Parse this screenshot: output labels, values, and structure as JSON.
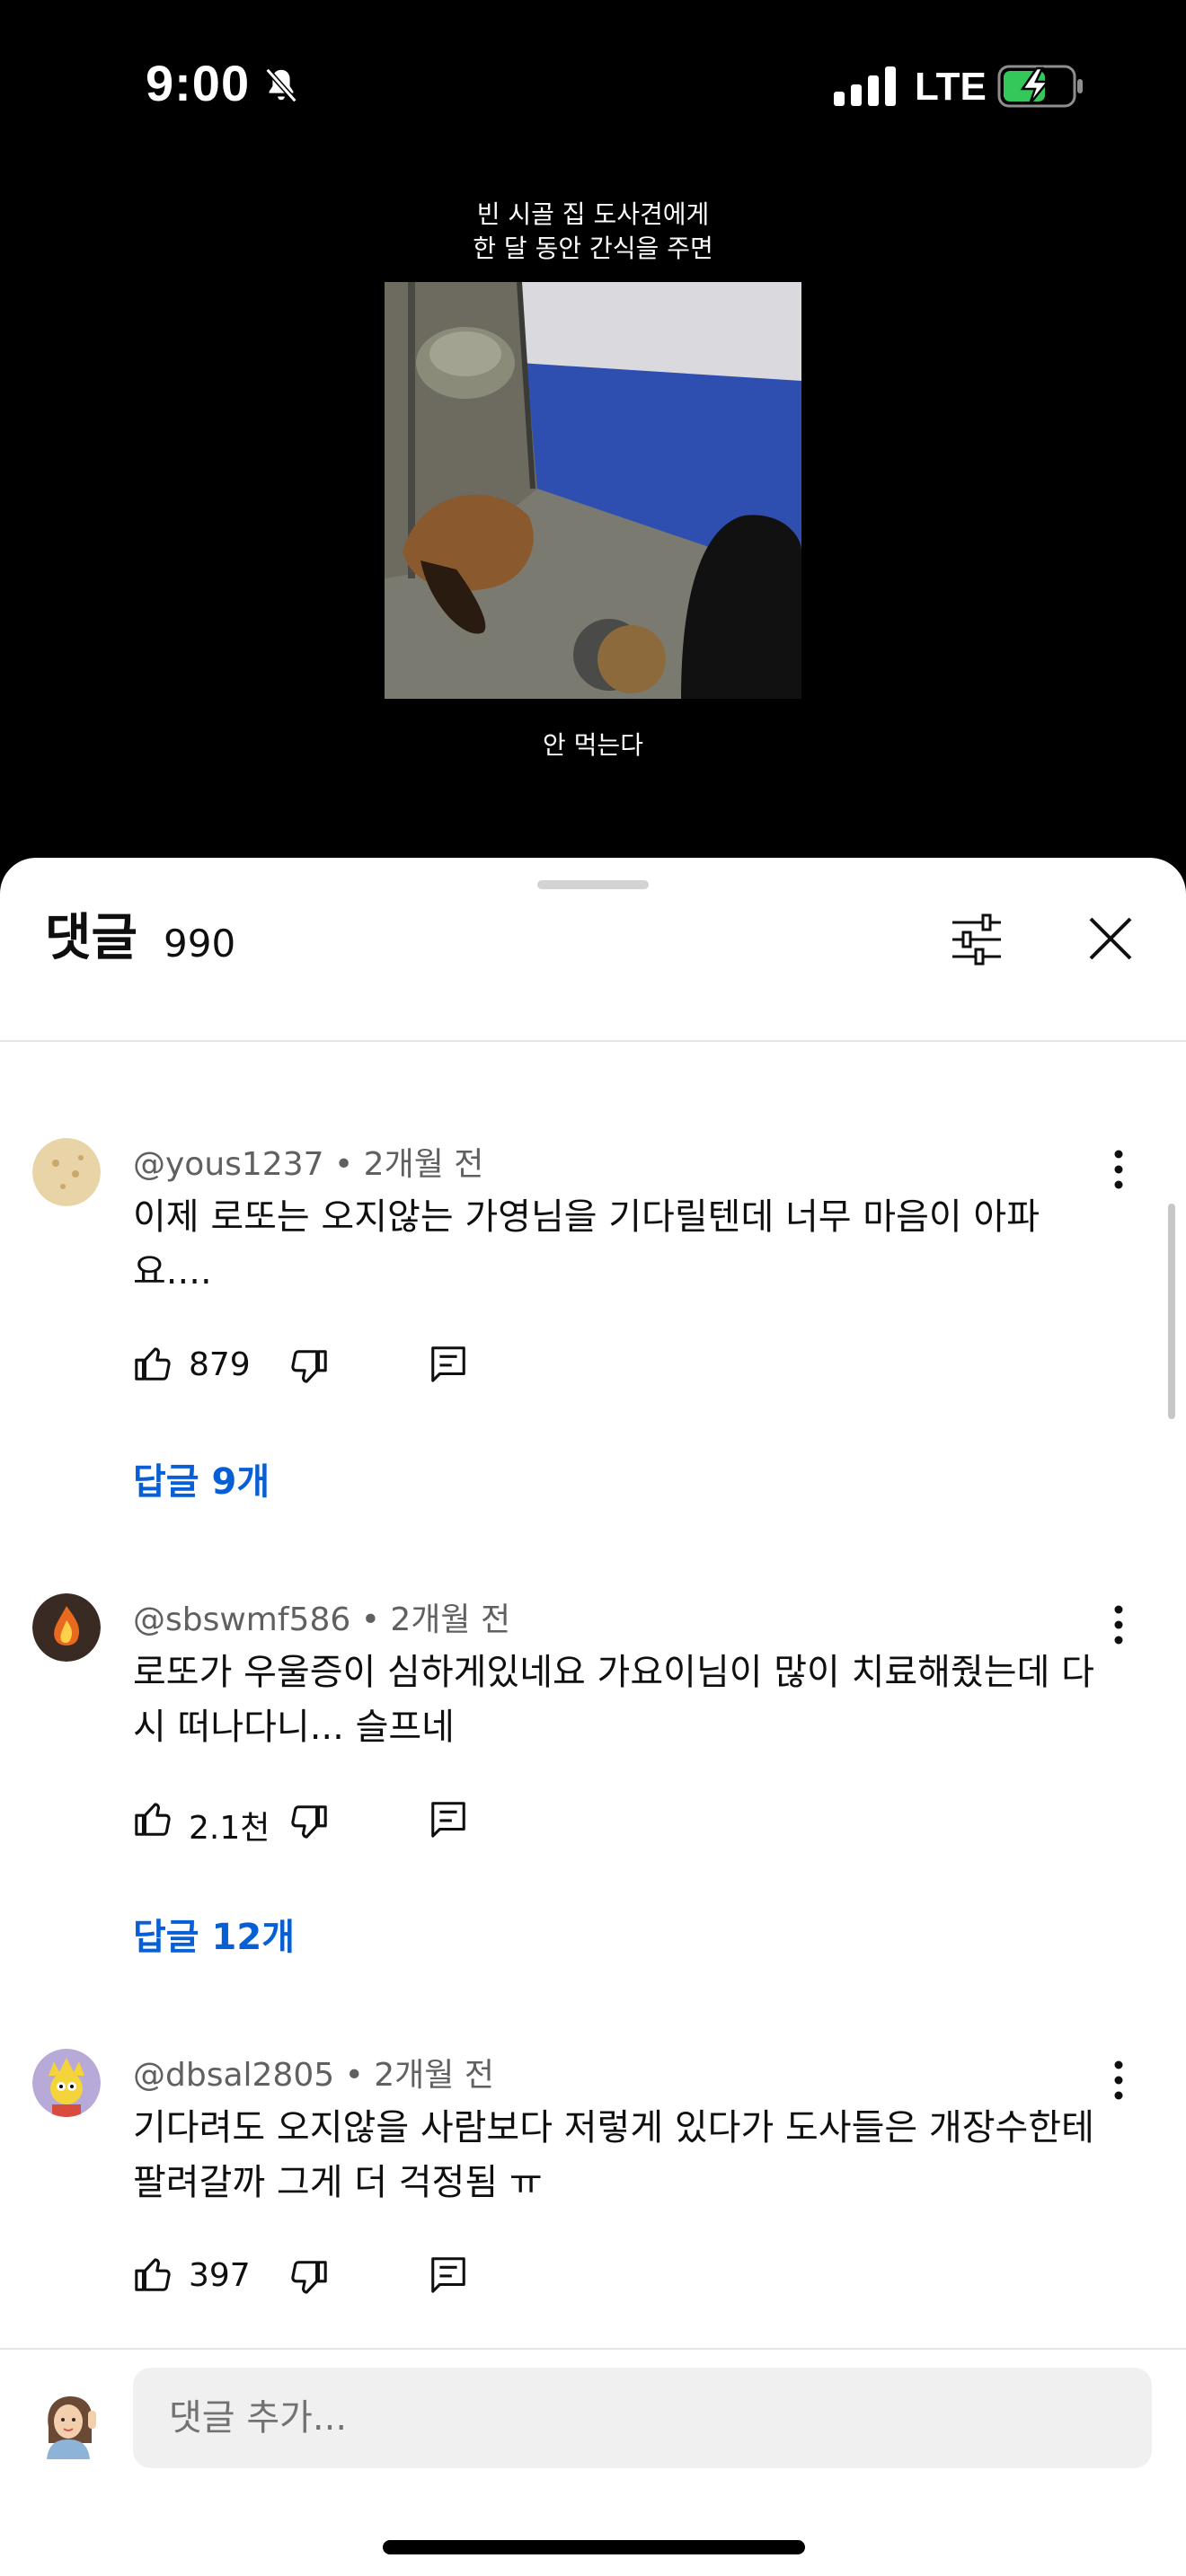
{
  "status_bar": {
    "time": "9:00",
    "network": "LTE"
  },
  "video": {
    "caption_top_line1": "빈 시골 집 도사견에게",
    "caption_top_line2": "한 달 동안 간식을 주면",
    "caption_bottom": "안 먹는다"
  },
  "comments_panel": {
    "title": "댓글",
    "count": "990",
    "input_placeholder": "댓글 추가..."
  },
  "comments": [
    {
      "author": "@yous1237",
      "time": "2개월 전",
      "text": "이제 로또는 오지않는 가영님을 기다릴텐데 너무 마음이 아파요....",
      "likes": "879",
      "replies": "답글 9개"
    },
    {
      "author": "@sbswmf586",
      "time": "2개월 전",
      "text": "로또가 우울증이 심하게있네요 가요이님이 많이 치료해줬는데 다시 떠나다니... 슬프네",
      "likes": "2.1천",
      "replies": "답글 12개"
    },
    {
      "author": "@dbsal2805",
      "time": "2개월 전",
      "text": "기다려도 오지않을 사람보다 저렇게 있다가 도사들은 개장수한테 팔려갈까 그게 더 걱정됨 ㅠ",
      "likes": "397"
    }
  ],
  "colors": {
    "link_blue": "#065fd4",
    "meta_gray": "#606060",
    "battery_green": "#34c759"
  }
}
